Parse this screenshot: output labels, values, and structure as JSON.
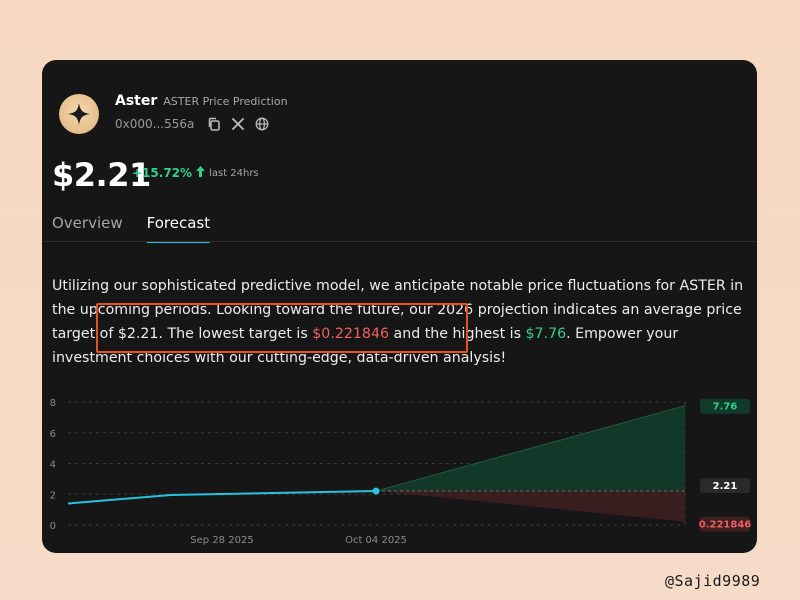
{
  "header": {
    "name": "Aster",
    "subtitle": "ASTER Price Prediction",
    "address": "0x000...556a"
  },
  "price": {
    "value": "$2.21",
    "change": "+15.72%",
    "change_note": "last 24hrs"
  },
  "tabs": [
    {
      "label": "Overview",
      "active": false
    },
    {
      "label": "Forecast",
      "active": true
    }
  ],
  "description": {
    "part1": "Utilizing our sophisticated predictive model, we anticipate notable price fluctuations for ASTER in the upcoming periods. Looking toward the future, our 2026 projection indicates an average price target of $2.21. The lowest target is ",
    "low": "$0.221846",
    "part2": " and the highest is ",
    "high": "$7.76",
    "part3": ". Empower your investment choices with our cutting-edge, data-driven analysis!"
  },
  "colors": {
    "accent": "#29c2dc",
    "positive": "#2fd08e",
    "negative": "#ef5f5f",
    "highlight_border": "#e2531f"
  },
  "chart_data": {
    "type": "area",
    "ylim": [
      0,
      8
    ],
    "yticks": [
      "0",
      "2",
      "4",
      "6",
      "8"
    ],
    "xticks": [
      "Sep 28 2025",
      "Oct 04 2025"
    ],
    "history": [
      1.4,
      1.95,
      2.08,
      2.21
    ],
    "forecast": {
      "average": 2.21,
      "high": 7.76,
      "low": 0.221846
    },
    "labels": {
      "high": "7.76",
      "average": "2.21",
      "low": "0.221846"
    },
    "grid": true
  },
  "watermark": "@Sajid9989"
}
